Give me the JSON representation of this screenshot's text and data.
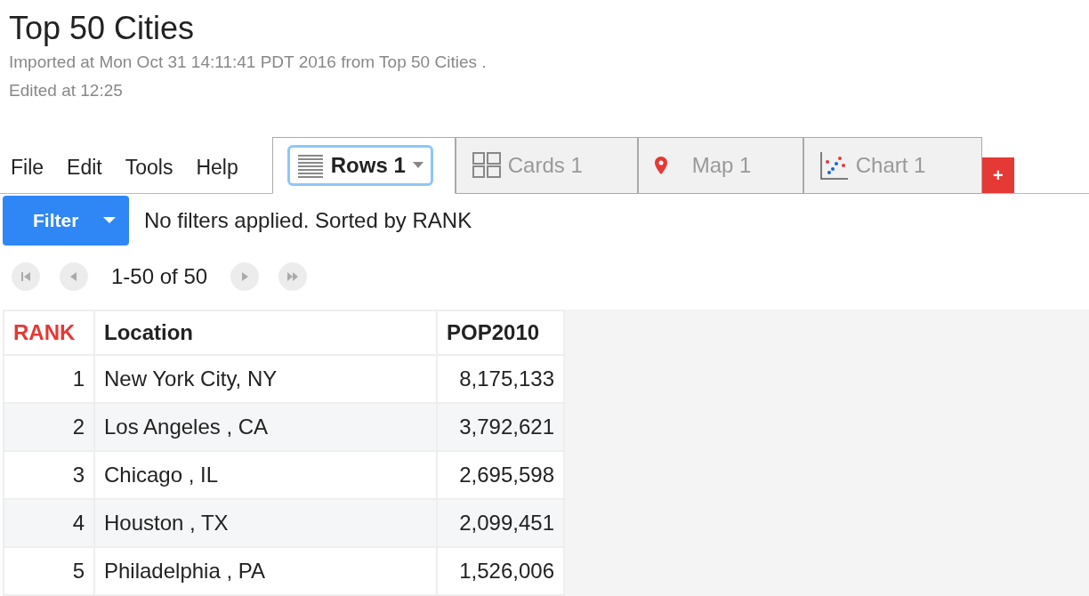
{
  "title": "Top 50 Cities",
  "meta": [
    "Imported at Mon Oct 31 14:11:41 PDT 2016 from Top 50 Cities .",
    "Edited at 12:25"
  ],
  "menu": [
    "File",
    "Edit",
    "Tools",
    "Help"
  ],
  "tabs": [
    {
      "kind": "rows",
      "label": "Rows 1",
      "selected": true
    },
    {
      "kind": "cards",
      "label": "Cards 1",
      "selected": false
    },
    {
      "kind": "map",
      "label": "Map 1",
      "selected": false
    },
    {
      "kind": "chart",
      "label": "Chart 1",
      "selected": false
    }
  ],
  "add_tab": "+",
  "filter": {
    "label": "Filter",
    "status": "No filters applied. Sorted by RANK"
  },
  "pager": "1-50 of 50",
  "table": {
    "columns": [
      {
        "label": "RANK",
        "sorted": true,
        "kind": "number"
      },
      {
        "label": "Location",
        "sorted": false,
        "kind": "text"
      },
      {
        "label": "POP2010",
        "sorted": false,
        "kind": "number"
      }
    ],
    "rows": [
      [
        "1",
        "New York City, NY",
        "8,175,133"
      ],
      [
        "2",
        "Los Angeles , CA",
        "3,792,621"
      ],
      [
        "3",
        "Chicago , IL",
        "2,695,598"
      ],
      [
        "4",
        "Houston , TX",
        "2,099,451"
      ],
      [
        "5",
        "Philadelphia , PA",
        "1,526,006"
      ]
    ]
  }
}
